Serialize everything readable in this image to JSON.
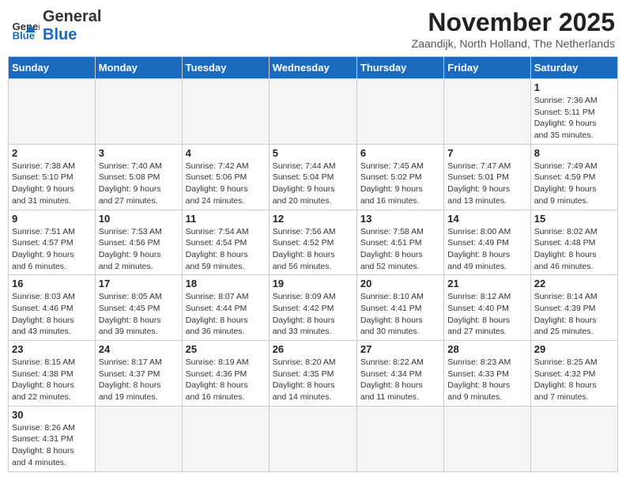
{
  "header": {
    "logo_general": "General",
    "logo_blue": "Blue",
    "month_title": "November 2025",
    "location": "Zaandijk, North Holland, The Netherlands"
  },
  "days_of_week": [
    "Sunday",
    "Monday",
    "Tuesday",
    "Wednesday",
    "Thursday",
    "Friday",
    "Saturday"
  ],
  "weeks": [
    [
      {
        "day": "",
        "info": ""
      },
      {
        "day": "",
        "info": ""
      },
      {
        "day": "",
        "info": ""
      },
      {
        "day": "",
        "info": ""
      },
      {
        "day": "",
        "info": ""
      },
      {
        "day": "",
        "info": ""
      },
      {
        "day": "1",
        "info": "Sunrise: 7:36 AM\nSunset: 5:11 PM\nDaylight: 9 hours\nand 35 minutes."
      }
    ],
    [
      {
        "day": "2",
        "info": "Sunrise: 7:38 AM\nSunset: 5:10 PM\nDaylight: 9 hours\nand 31 minutes."
      },
      {
        "day": "3",
        "info": "Sunrise: 7:40 AM\nSunset: 5:08 PM\nDaylight: 9 hours\nand 27 minutes."
      },
      {
        "day": "4",
        "info": "Sunrise: 7:42 AM\nSunset: 5:06 PM\nDaylight: 9 hours\nand 24 minutes."
      },
      {
        "day": "5",
        "info": "Sunrise: 7:44 AM\nSunset: 5:04 PM\nDaylight: 9 hours\nand 20 minutes."
      },
      {
        "day": "6",
        "info": "Sunrise: 7:45 AM\nSunset: 5:02 PM\nDaylight: 9 hours\nand 16 minutes."
      },
      {
        "day": "7",
        "info": "Sunrise: 7:47 AM\nSunset: 5:01 PM\nDaylight: 9 hours\nand 13 minutes."
      },
      {
        "day": "8",
        "info": "Sunrise: 7:49 AM\nSunset: 4:59 PM\nDaylight: 9 hours\nand 9 minutes."
      }
    ],
    [
      {
        "day": "9",
        "info": "Sunrise: 7:51 AM\nSunset: 4:57 PM\nDaylight: 9 hours\nand 6 minutes."
      },
      {
        "day": "10",
        "info": "Sunrise: 7:53 AM\nSunset: 4:56 PM\nDaylight: 9 hours\nand 2 minutes."
      },
      {
        "day": "11",
        "info": "Sunrise: 7:54 AM\nSunset: 4:54 PM\nDaylight: 8 hours\nand 59 minutes."
      },
      {
        "day": "12",
        "info": "Sunrise: 7:56 AM\nSunset: 4:52 PM\nDaylight: 8 hours\nand 56 minutes."
      },
      {
        "day": "13",
        "info": "Sunrise: 7:58 AM\nSunset: 4:51 PM\nDaylight: 8 hours\nand 52 minutes."
      },
      {
        "day": "14",
        "info": "Sunrise: 8:00 AM\nSunset: 4:49 PM\nDaylight: 8 hours\nand 49 minutes."
      },
      {
        "day": "15",
        "info": "Sunrise: 8:02 AM\nSunset: 4:48 PM\nDaylight: 8 hours\nand 46 minutes."
      }
    ],
    [
      {
        "day": "16",
        "info": "Sunrise: 8:03 AM\nSunset: 4:46 PM\nDaylight: 8 hours\nand 43 minutes."
      },
      {
        "day": "17",
        "info": "Sunrise: 8:05 AM\nSunset: 4:45 PM\nDaylight: 8 hours\nand 39 minutes."
      },
      {
        "day": "18",
        "info": "Sunrise: 8:07 AM\nSunset: 4:44 PM\nDaylight: 8 hours\nand 36 minutes."
      },
      {
        "day": "19",
        "info": "Sunrise: 8:09 AM\nSunset: 4:42 PM\nDaylight: 8 hours\nand 33 minutes."
      },
      {
        "day": "20",
        "info": "Sunrise: 8:10 AM\nSunset: 4:41 PM\nDaylight: 8 hours\nand 30 minutes."
      },
      {
        "day": "21",
        "info": "Sunrise: 8:12 AM\nSunset: 4:40 PM\nDaylight: 8 hours\nand 27 minutes."
      },
      {
        "day": "22",
        "info": "Sunrise: 8:14 AM\nSunset: 4:39 PM\nDaylight: 8 hours\nand 25 minutes."
      }
    ],
    [
      {
        "day": "23",
        "info": "Sunrise: 8:15 AM\nSunset: 4:38 PM\nDaylight: 8 hours\nand 22 minutes."
      },
      {
        "day": "24",
        "info": "Sunrise: 8:17 AM\nSunset: 4:37 PM\nDaylight: 8 hours\nand 19 minutes."
      },
      {
        "day": "25",
        "info": "Sunrise: 8:19 AM\nSunset: 4:36 PM\nDaylight: 8 hours\nand 16 minutes."
      },
      {
        "day": "26",
        "info": "Sunrise: 8:20 AM\nSunset: 4:35 PM\nDaylight: 8 hours\nand 14 minutes."
      },
      {
        "day": "27",
        "info": "Sunrise: 8:22 AM\nSunset: 4:34 PM\nDaylight: 8 hours\nand 11 minutes."
      },
      {
        "day": "28",
        "info": "Sunrise: 8:23 AM\nSunset: 4:33 PM\nDaylight: 8 hours\nand 9 minutes."
      },
      {
        "day": "29",
        "info": "Sunrise: 8:25 AM\nSunset: 4:32 PM\nDaylight: 8 hours\nand 7 minutes."
      }
    ],
    [
      {
        "day": "30",
        "info": "Sunrise: 8:26 AM\nSunset: 4:31 PM\nDaylight: 8 hours\nand 4 minutes."
      },
      {
        "day": "",
        "info": ""
      },
      {
        "day": "",
        "info": ""
      },
      {
        "day": "",
        "info": ""
      },
      {
        "day": "",
        "info": ""
      },
      {
        "day": "",
        "info": ""
      },
      {
        "day": "",
        "info": ""
      }
    ]
  ]
}
